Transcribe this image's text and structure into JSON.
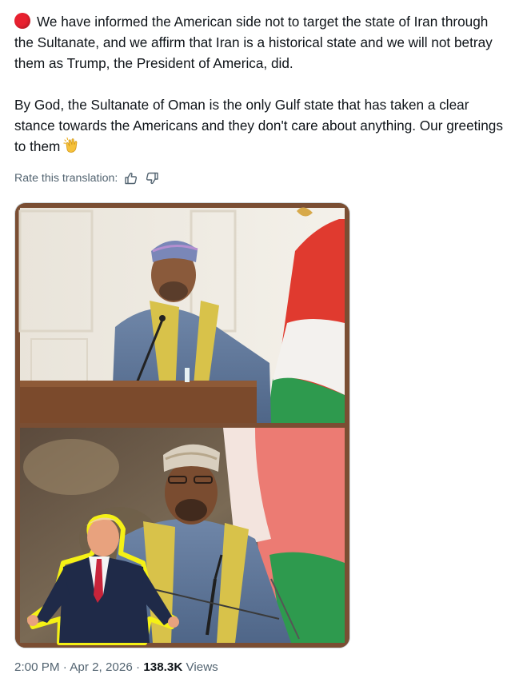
{
  "post": {
    "paragraph1": "We have informed the American side not to target the state of Iran through the Sultanate, and we affirm that Iran is a historical state and we will not betray them as Trump, the President of America, did.",
    "paragraph2": "By God, the Sultanate of Oman is the only Gulf state that has taken a clear stance towards the Americans and they don't care about anything. Our greetings to them",
    "lead_icon": "red-circle-emoji",
    "end_icon": "clapping-hands-emoji"
  },
  "translation": {
    "label": "Rate this translation:",
    "thumbs_up_icon": "thumbs-up-icon",
    "thumbs_down_icon": "thumbs-down-icon"
  },
  "meta": {
    "time": "2:00 PM",
    "separator": "·",
    "date": "Apr 2, 2026",
    "views_count": "138.3K",
    "views_label": "Views"
  },
  "colors": {
    "text": "#0f1419",
    "secondary": "#536471",
    "red_dot": "#e8202f",
    "flag_red": "#e03a2f",
    "flag_green": "#2e9a4e"
  }
}
